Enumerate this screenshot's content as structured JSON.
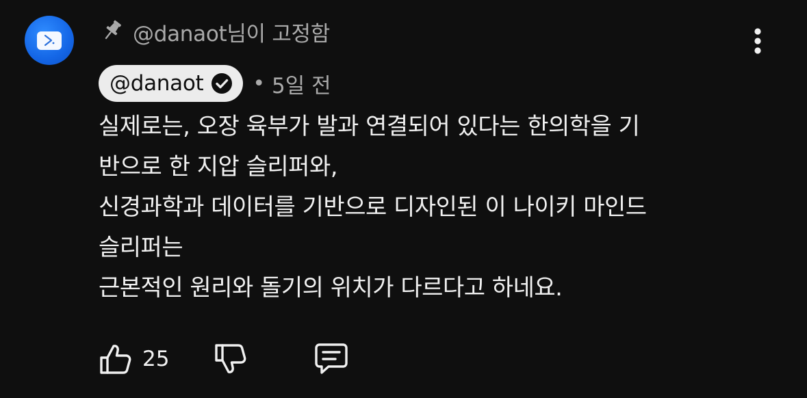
{
  "comment": {
    "avatar_icon": "chevron-right-icon",
    "pinned": {
      "icon": "pin-icon",
      "text": "@danaot님이 고정함"
    },
    "author": {
      "handle": "@danaot",
      "verified_icon": "verified-check-icon"
    },
    "separator": "•",
    "timestamp": "5일 전",
    "body_lines": [
      "실제로는, 오장 육부가 발과 연결되어 있다는 한의학을 기",
      "반으로 한 지압 슬리퍼와,",
      "신경과학과 데이터를 기반으로 디자인된 이 나이키 마인드",
      "슬리퍼는",
      "근본적인 원리와 돌기의 위치가 다르다고 하네요."
    ],
    "actions": {
      "like_icon": "thumbs-up-icon",
      "like_count": "25",
      "dislike_icon": "thumbs-down-icon",
      "reply_icon": "reply-comment-icon",
      "more_icon": "more-vertical-icon"
    }
  },
  "colors": {
    "background": "#0f0f0f",
    "text_primary": "#f1f1f1",
    "text_secondary": "#aaaaaa",
    "chip_background": "#ececec",
    "avatar_blue": "#1466e6"
  }
}
